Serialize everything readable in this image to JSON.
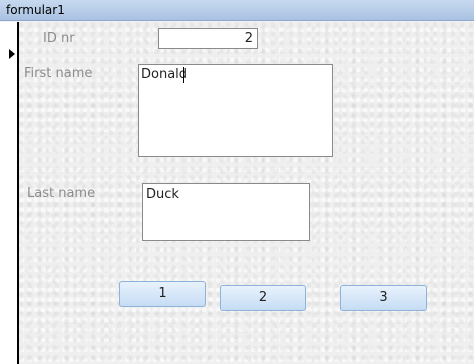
{
  "window": {
    "title": "formular1"
  },
  "form": {
    "id_label": "ID nr",
    "id_value": "2",
    "first_name_label": "First name",
    "first_name_value": "Donald",
    "last_name_label": "Last name",
    "last_name_value": "Duck"
  },
  "buttons": [
    {
      "label": "1"
    },
    {
      "label": "2"
    },
    {
      "label": "3"
    }
  ],
  "icons": {
    "record_selector": "record-pointer-icon"
  }
}
